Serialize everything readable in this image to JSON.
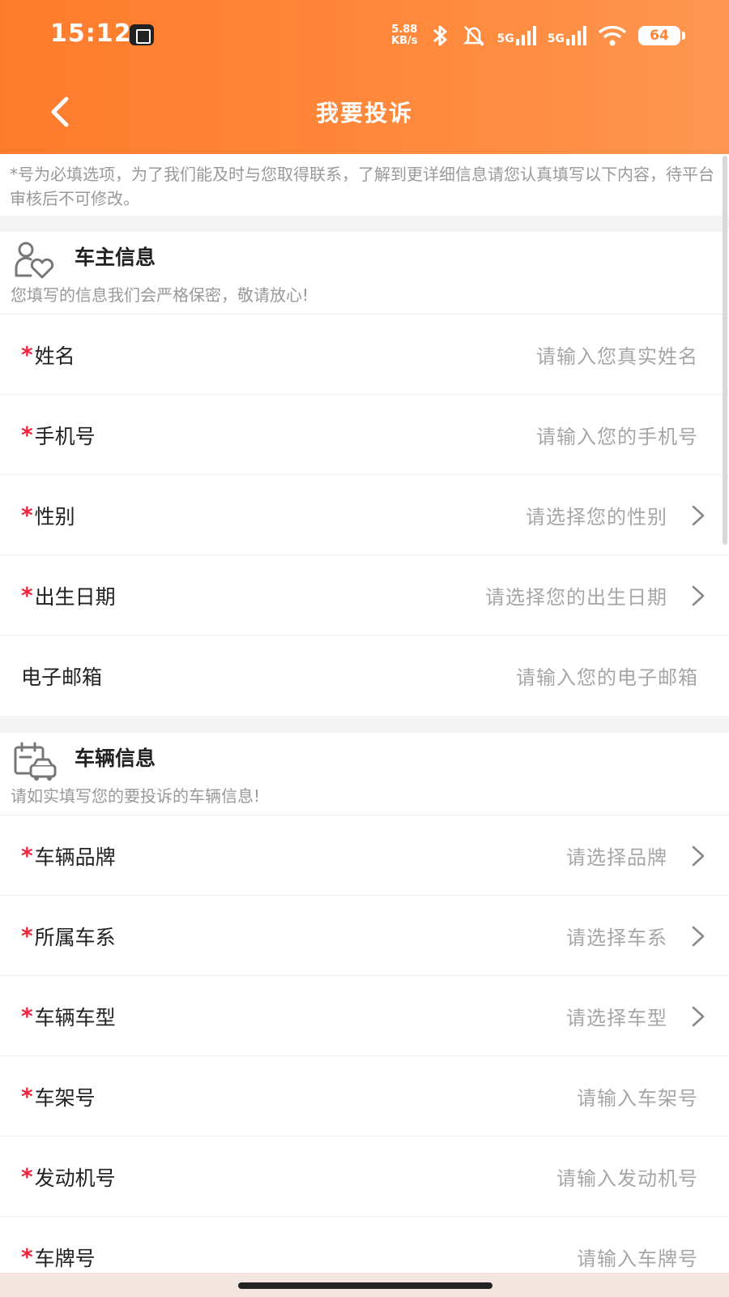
{
  "status_bar": {
    "time": "15:12",
    "net_speed_value": "5.88",
    "net_speed_unit": "KB/s",
    "signal1_label": "5G",
    "signal2_label": "5G",
    "battery": "64"
  },
  "nav": {
    "title": "我要投诉",
    "back_icon": "chevron-left-icon"
  },
  "notice": "*号为必填选项，为了我们能及时与您取得联系，了解到更详细信息请您认真填写以下内容，待平台审核后不可修改。",
  "owner_section": {
    "title": "车主信息",
    "subtitle": "您填写的信息我们会严格保密，敬请放心!",
    "icon": "user-heart-icon",
    "fields": [
      {
        "label": "姓名",
        "required": "*",
        "placeholder": "请输入您真实姓名",
        "kind": "input"
      },
      {
        "label": "手机号",
        "required": "*",
        "placeholder": "请输入您的手机号",
        "kind": "input"
      },
      {
        "label": "性别",
        "required": "*",
        "placeholder": "请选择您的性别",
        "kind": "select"
      },
      {
        "label": "出生日期",
        "required": "*",
        "placeholder": "请选择您的出生日期",
        "kind": "select"
      },
      {
        "label": "电子邮箱",
        "required": "",
        "placeholder": "请输入您的电子邮箱",
        "kind": "input"
      }
    ]
  },
  "vehicle_section": {
    "title": "车辆信息",
    "subtitle": "请如实填写您的要投诉的车辆信息!",
    "icon": "car-calendar-icon",
    "fields": [
      {
        "label": "车辆品牌",
        "required": "*",
        "placeholder": "请选择品牌",
        "kind": "select"
      },
      {
        "label": "所属车系",
        "required": "*",
        "placeholder": "请选择车系",
        "kind": "select"
      },
      {
        "label": "车辆车型",
        "required": "*",
        "placeholder": "请选择车型",
        "kind": "select"
      },
      {
        "label": "车架号",
        "required": "*",
        "placeholder": "请输入车架号",
        "kind": "input"
      },
      {
        "label": "发动机号",
        "required": "*",
        "placeholder": "请输入发动机号",
        "kind": "input"
      },
      {
        "label": "车牌号",
        "required": "*",
        "placeholder": "请输入车牌号",
        "kind": "input"
      }
    ]
  },
  "colors": {
    "header": "#ff8437",
    "required": "#f0243c",
    "placeholder": "#a6a6a6"
  }
}
